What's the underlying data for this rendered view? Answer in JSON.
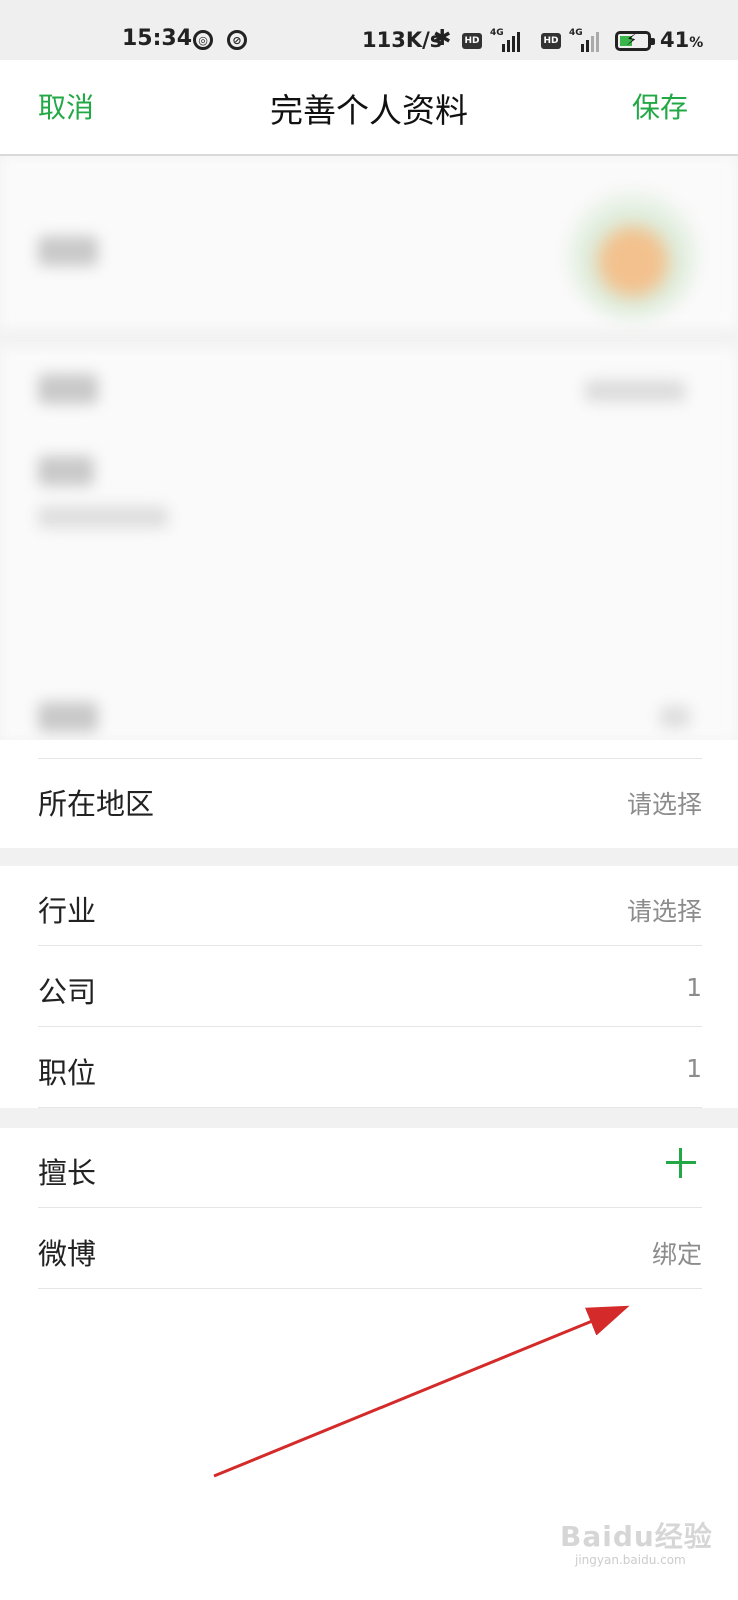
{
  "status_bar": {
    "time": "15:34",
    "net_speed": "113K/s",
    "sim1_hd": "HD",
    "sim1_net": "4G",
    "sim2_hd": "HD",
    "sim2_net": "4G",
    "battery_percent": "41",
    "battery_unit": "%",
    "battery_level": 0.41,
    "charging": true
  },
  "nav": {
    "cancel": "取消",
    "title": "完善个人资料",
    "save": "保存"
  },
  "fields_group1": [
    {
      "label": "所在地区",
      "value": "请选择"
    }
  ],
  "fields_group2": [
    {
      "label": "行业",
      "value": "请选择"
    },
    {
      "label": "公司",
      "value": "1"
    },
    {
      "label": "职位",
      "value": "1"
    }
  ],
  "fields_group3": [
    {
      "label": "擅长",
      "value": ""
    },
    {
      "label": "微博",
      "value": "绑定"
    }
  ],
  "watermark": {
    "brand": "Baidu经验",
    "url": "jingyan.baidu.com"
  },
  "colors": {
    "accent": "#22a845",
    "annotation_arrow": "#d42a2a",
    "muted_text": "#8c8c8c"
  }
}
